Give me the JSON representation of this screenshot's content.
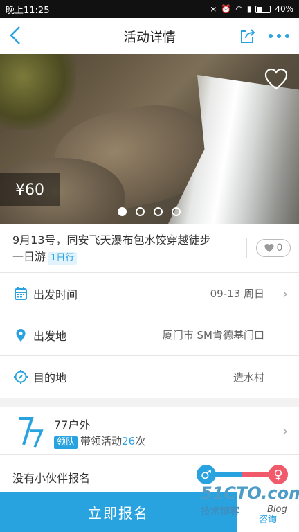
{
  "status_bar": {
    "time": "晚上11:25",
    "battery": "40%"
  },
  "nav": {
    "back": "<",
    "title": "活动详情",
    "share_icon": "share-icon",
    "more_icon": "more-icon"
  },
  "hero": {
    "price": "¥60",
    "slide_count": 4,
    "active_slide": 1
  },
  "activity": {
    "title": "9月13号，同安飞天瀑布包水饺穿越徒步一日游",
    "day_badge": "1日行",
    "likes": "0"
  },
  "info": {
    "departure_time_label": "出发时间",
    "departure_time_value": "09-13 周日",
    "departure_place_label": "出发地",
    "departure_place_value": "厦门市 SM肯德基门口",
    "destination_label": "目的地",
    "destination_value": "造水村"
  },
  "organizer": {
    "logo_text": "77",
    "name": "77户外",
    "badge": "领队",
    "led_prefix": "带领活动",
    "led_count": "26",
    "led_suffix": "次"
  },
  "participants": {
    "empty_text": "没有小伙伴报名"
  },
  "bottom": {
    "signup": "立即报名",
    "consult": "咨询"
  },
  "watermark": {
    "site": "51CTO.com",
    "sub": "技术博客",
    "blog": "Blog"
  },
  "colors": {
    "accent": "#29a3e0",
    "female": "#f05a6a"
  }
}
